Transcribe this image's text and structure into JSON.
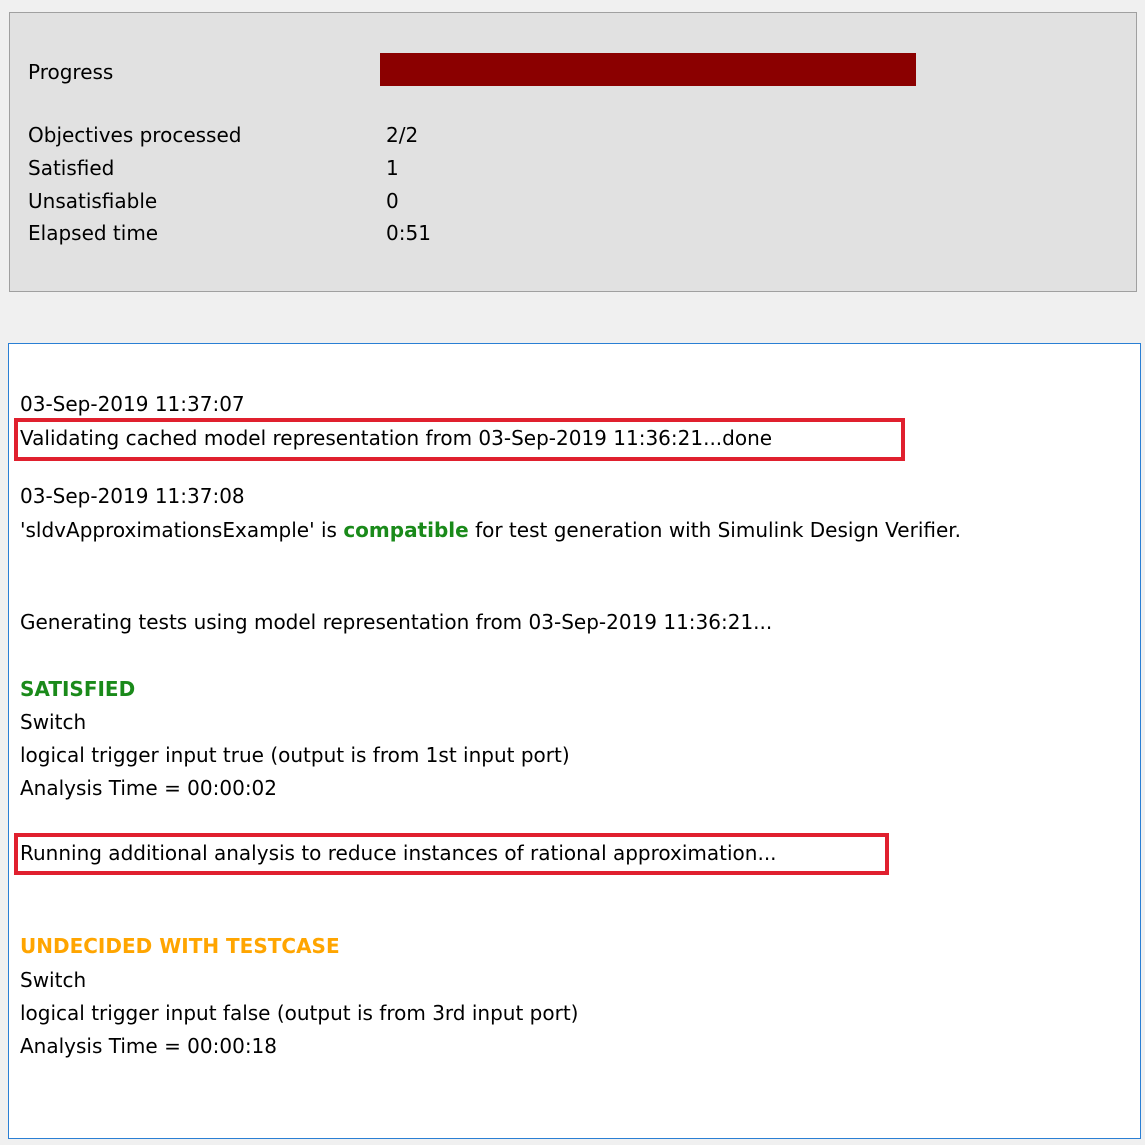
{
  "status": {
    "progress_label": "Progress",
    "progress_fraction": 1.0,
    "progress_color": "#8b0000",
    "rows": [
      {
        "label": "Objectives processed",
        "value": "2/2"
      },
      {
        "label": "Satisfied",
        "value": "1"
      },
      {
        "label": "Unsatisfiable",
        "value": "0"
      },
      {
        "label": "Elapsed time",
        "value": "0:51"
      }
    ]
  },
  "log": {
    "ts1": "03-Sep-2019 11:37:07",
    "validating": "Validating cached model representation from 03-Sep-2019 11:36:21...done",
    "ts2": "03-Sep-2019 11:37:08",
    "compat_pre": "'sldvApproximationsExample' is ",
    "compat_word": "compatible",
    "compat_post": " for test generation with Simulink Design Verifier.",
    "generating": "Generating tests using model representation from 03-Sep-2019 11:36:21...",
    "satisfied_heading": "SATISFIED",
    "sat_block": "Switch",
    "sat_desc": "logical trigger input true (output is from 1st input port)",
    "sat_time": "Analysis Time = 00:00:02",
    "running": "Running additional analysis to reduce instances of rational approximation...",
    "undecided_heading": "UNDECIDED WITH TESTCASE",
    "und_block": "Switch",
    "und_desc": "logical trigger input false (output is from 3rd input port)",
    "und_time": "Analysis Time = 00:00:18"
  },
  "colors": {
    "satisfied": "#1a8a1a",
    "undecided": "#ffa500",
    "highlight": "#e0202e",
    "log_border": "#2a7fd4"
  }
}
